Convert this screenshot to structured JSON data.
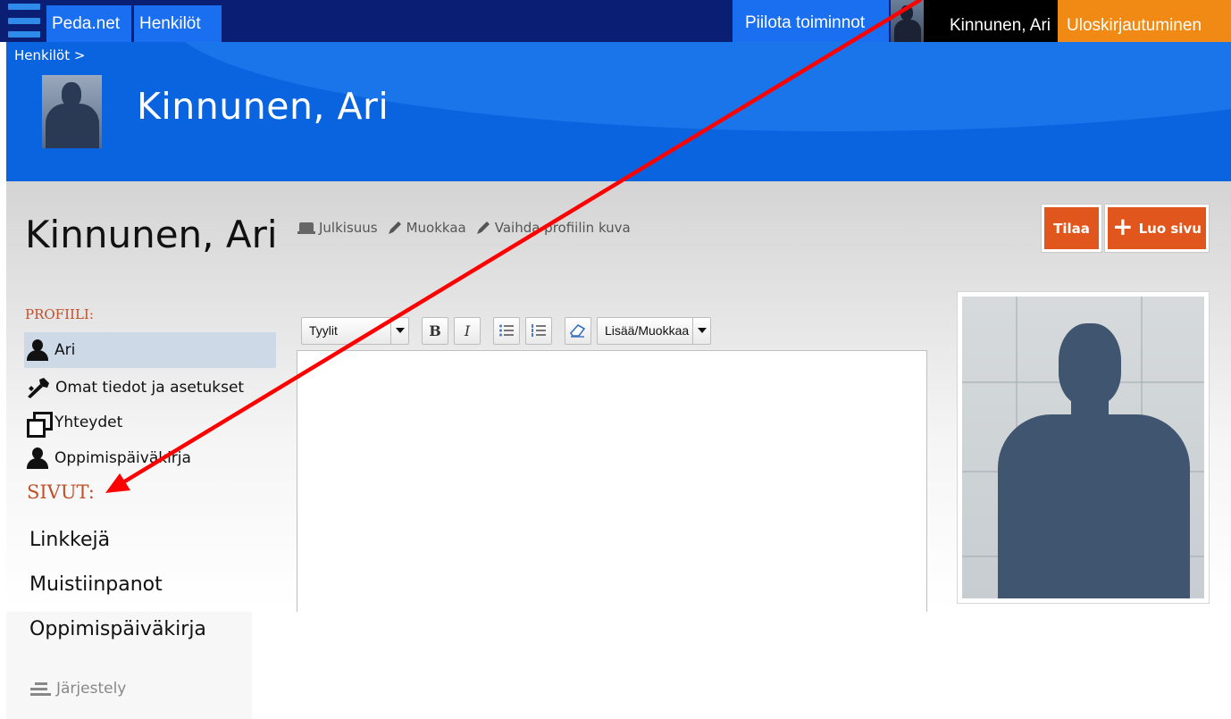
{
  "topbar": {
    "site_tab": "Peda.net",
    "people_tab": "Henkilöt",
    "hide_actions": "Piilota toiminnot",
    "user_name": "Kinnunen, Ari",
    "logout": "Uloskirjautuminen"
  },
  "banner": {
    "breadcrumb": "Henkilöt >",
    "title": "Kinnunen, Ari"
  },
  "page": {
    "title": "Kinnunen, Ari",
    "actions": {
      "visibility": "Julkisuus",
      "edit": "Muokkaa",
      "change_photo": "Vaihda profiilin kuva"
    },
    "subscribe": "Tilaa",
    "create_page": "Luo sivu"
  },
  "sidebar": {
    "profile_label": "PROFIILI:",
    "profile_items": [
      {
        "label": "Ari",
        "icon": "person-icon",
        "active": true
      },
      {
        "label": "Omat tiedot ja asetukset",
        "icon": "tools-icon"
      },
      {
        "label": "Yhteydet",
        "icon": "windows-icon"
      },
      {
        "label": "Oppimispäiväkirja",
        "icon": "person-icon"
      }
    ],
    "pages_label": "SIVUT:",
    "pages": [
      "Linkkejä",
      "Muistiinpanot",
      "Oppimispäiväkirja"
    ],
    "arrange": "Järjestely"
  },
  "editor": {
    "styles_select": "Tyylit",
    "bold": "B",
    "italic": "I",
    "insert_edit_select": "Lisää/Muokkaa"
  },
  "colors": {
    "topbar_navy": "#0a1f73",
    "banner_blue": "#0a64e0",
    "tab_blue": "#1a6ef0",
    "logout_orange": "#f08a14",
    "button_orange": "#e0561c",
    "section_label": "#c0502a",
    "annotation_arrow": "#ff0000"
  }
}
